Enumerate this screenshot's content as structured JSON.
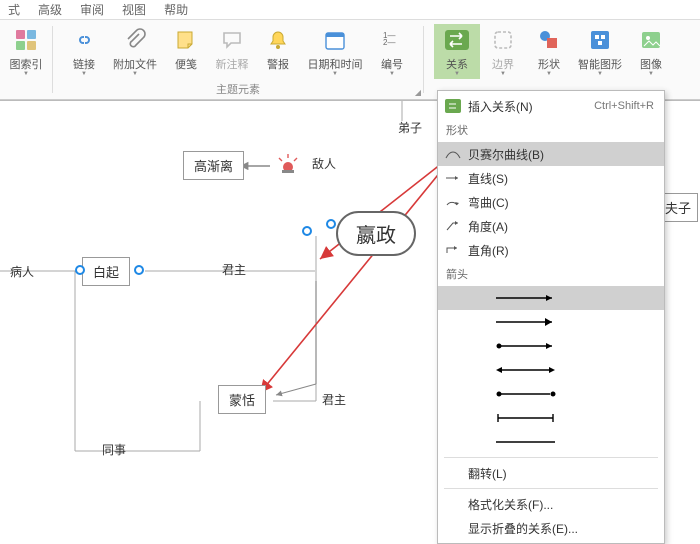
{
  "tabs": {
    "t1": "式",
    "t2": "高级",
    "t3": "审阅",
    "t4": "视图",
    "t5": "帮助"
  },
  "ribbon": {
    "imgidx": "图索引",
    "link": "链接",
    "attach": "附加文件",
    "note": "便笺",
    "comment": "新注释",
    "alarm": "警报",
    "date": "日期和时间",
    "num": "编号",
    "group1": "主题元素",
    "rel": "关系",
    "border": "边界",
    "shape": "形状",
    "smart": "智能图形",
    "image": "图像"
  },
  "menu": {
    "insert": "插入关系(N)",
    "shortcut": "Ctrl+Shift+R",
    "h1": "形状",
    "bezier": "贝赛尔曲线(B)",
    "straight": "直线(S)",
    "curve": "弯曲(C)",
    "angle": "角度(A)",
    "right": "直角(R)",
    "h2": "箭头",
    "flip": "翻转(L)",
    "format": "格式化关系(F)...",
    "fold": "显示折叠的关系(E)..."
  },
  "nodes": {
    "center": "嬴政",
    "gaoj": "高渐离",
    "baiqi": "白起",
    "mengt": "蒙恬",
    "bingr": "病人",
    "dizi": "弟子",
    "diren": "敌人",
    "junzhu1": "君主",
    "junzhu2": "君主",
    "tongshi": "同事",
    "laofuzi": "老夫子"
  }
}
